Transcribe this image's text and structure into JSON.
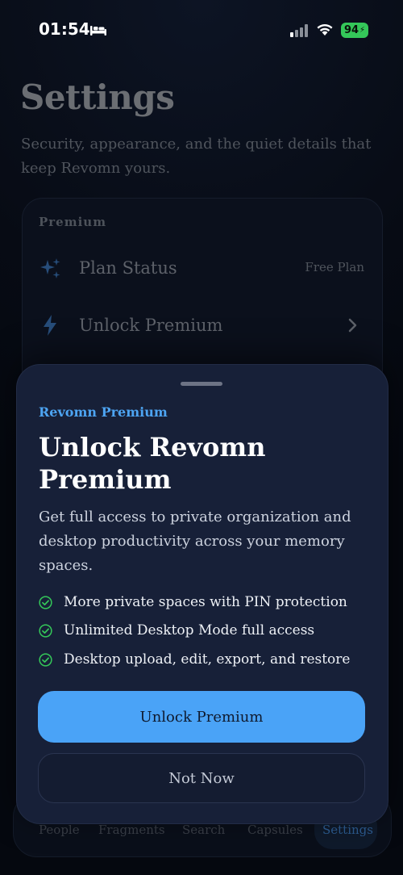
{
  "status_bar": {
    "time": "01:54",
    "battery": "94",
    "icons": [
      "bed-icon",
      "cellular-signal-icon",
      "wifi-icon",
      "battery-icon"
    ]
  },
  "page": {
    "title": "Settings",
    "subtitle": "Security, appearance, and the quiet details that keep Revomn yours."
  },
  "premium_section": {
    "label": "Premium",
    "rows": [
      {
        "label": "Plan Status",
        "value": "Free Plan",
        "icon": "sparkles-icon"
      },
      {
        "label": "Unlock Premium",
        "icon": "bolt-icon",
        "trailing_icon": "chevron-right-icon"
      }
    ]
  },
  "tab_bar": {
    "tabs": [
      {
        "label": "People"
      },
      {
        "label": "Fragments"
      },
      {
        "label": "Search"
      },
      {
        "label": "Capsules"
      },
      {
        "label": "Settings",
        "active": true
      }
    ]
  },
  "sheet": {
    "eyebrow": "Revomn Premium",
    "title": "Unlock Revomn Premium",
    "description": "Get full access to private organization and desktop productivity across your memory spaces.",
    "features": [
      "More private spaces with PIN protection",
      "Unlimited Desktop Mode full access",
      "Desktop upload, edit, export, and restore"
    ],
    "primary_button": "Unlock Premium",
    "secondary_button": "Not Now"
  },
  "colors": {
    "accent": "#4aa3f7",
    "sheet_background": "#172038",
    "check": "#34c759",
    "battery": "#34c759"
  }
}
